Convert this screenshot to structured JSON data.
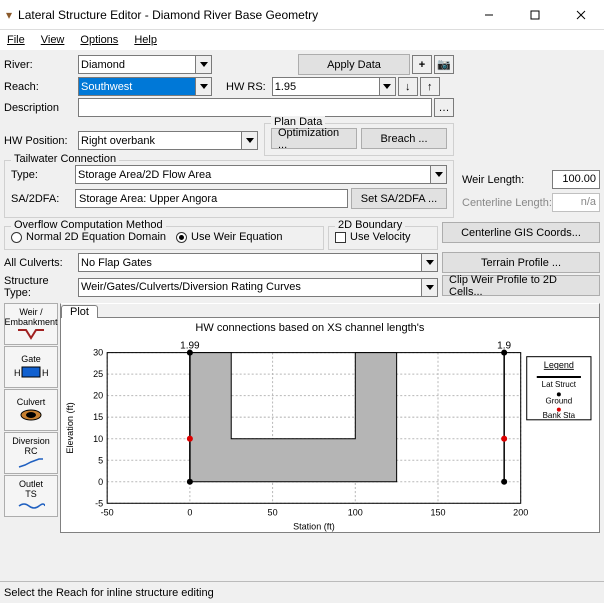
{
  "window": {
    "title": "Lateral Structure Editor - Diamond River Base Geometry"
  },
  "menu": {
    "file": "File",
    "view": "View",
    "options": "Options",
    "help": "Help"
  },
  "fields": {
    "river_lbl": "River:",
    "river_val": "Diamond",
    "reach_lbl": "Reach:",
    "reach_val": "Southwest",
    "hwrs_lbl": "HW RS:",
    "hwrs_val": "1.95",
    "desc_lbl": "Description",
    "desc_val": "",
    "hwpos_lbl": "HW Position:",
    "hwpos_val": "Right overbank",
    "tw_legend": "Tailwater Connection",
    "type_lbl": "Type:",
    "type_val": "Storage Area/2D Flow Area",
    "sa_lbl": "SA/2DFA:",
    "sa_val": "Storage Area: Upper Angora",
    "plandata_legend": "Plan Data",
    "opt_btn": "Optimization ...",
    "breach_btn": "Breach ...",
    "setsa_btn": "Set SA/2DFA ...",
    "overflow_legend": "Overflow Computation Method",
    "rad_normal": "Normal 2D Equation Domain",
    "rad_weir": "Use Weir Equation",
    "bound_legend": "2D Boundary",
    "chk_vel": "Use Velocity",
    "allculv_lbl": "All Culverts:",
    "allculv_val": "No Flap Gates",
    "struct_lbl": "Structure Type:",
    "struct_val": "Weir/Gates/Culverts/Diversion Rating Curves",
    "apply_btn": "Apply Data",
    "weir_len_lbl": "Weir Length:",
    "weir_len_val": "100.00",
    "cent_len_lbl": "Centerline Length:",
    "cent_len_val": "n/a",
    "gis_btn": "Centerline GIS Coords...",
    "terrain_btn": "Terrain Profile ...",
    "clip_btn": "Clip Weir Profile to 2D Cells..."
  },
  "tools": {
    "weir": "Weir /\nEmbankment",
    "gate": "Gate",
    "culvert": "Culvert",
    "div": "Diversion\nRC",
    "outlet": "Outlet\nTS"
  },
  "tabs": {
    "plot": "Plot"
  },
  "status": "Select the Reach for inline structure editing",
  "chart_data": {
    "type": "line",
    "title": "HW connections based on XS channel length's",
    "xlabel": "Station (ft)",
    "ylabel": "Elevation (ft)",
    "xlim": [
      -50,
      200
    ],
    "ylim": [
      -5,
      30
    ],
    "xticks": [
      -50,
      0,
      50,
      100,
      150,
      200
    ],
    "yticks": [
      -5,
      0,
      5,
      10,
      15,
      20,
      25,
      30
    ],
    "top_labels": [
      {
        "x": 0,
        "label": "1.99"
      },
      {
        "x": 190,
        "label": "1.9"
      }
    ],
    "series": [
      {
        "name": "Lat Struct",
        "x": [
          0,
          0,
          25,
          25,
          100,
          100,
          125,
          125
        ],
        "y": [
          0,
          30,
          30,
          10,
          10,
          30,
          30,
          0
        ],
        "fill": true,
        "color": "#b5b5b5",
        "stroke": "#000"
      },
      {
        "name": "Ground",
        "points": [
          {
            "x": 0,
            "y": 30,
            "bottom": 0
          },
          {
            "x": 190,
            "y": 30,
            "bottom": 0
          }
        ],
        "color": "#000"
      },
      {
        "name": "Bank Sta",
        "points": [
          {
            "x": 0,
            "y": 10
          },
          {
            "x": 190,
            "y": 10
          }
        ],
        "color": "#d00"
      }
    ],
    "legend": [
      "Lat Struct",
      "Ground",
      "Bank Sta"
    ]
  }
}
